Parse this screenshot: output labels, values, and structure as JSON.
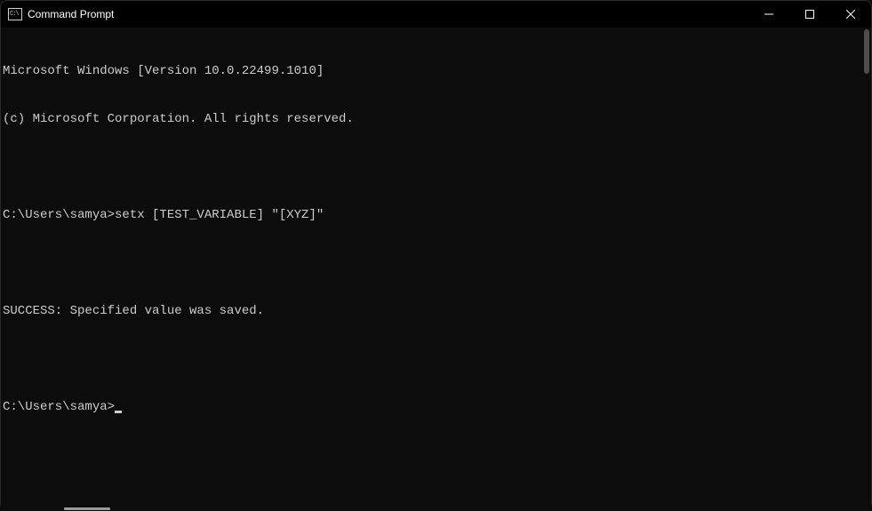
{
  "titlebar": {
    "title": "Command Prompt",
    "icon_text": "C:\\"
  },
  "terminal": {
    "lines": [
      "Microsoft Windows [Version 10.0.22499.1010]",
      "(c) Microsoft Corporation. All rights reserved.",
      "",
      "C:\\Users\\samya>setx [TEST_VARIABLE] \"[XYZ]\"",
      "",
      "SUCCESS: Specified value was saved.",
      ""
    ],
    "prompt": "C:\\Users\\samya>"
  }
}
